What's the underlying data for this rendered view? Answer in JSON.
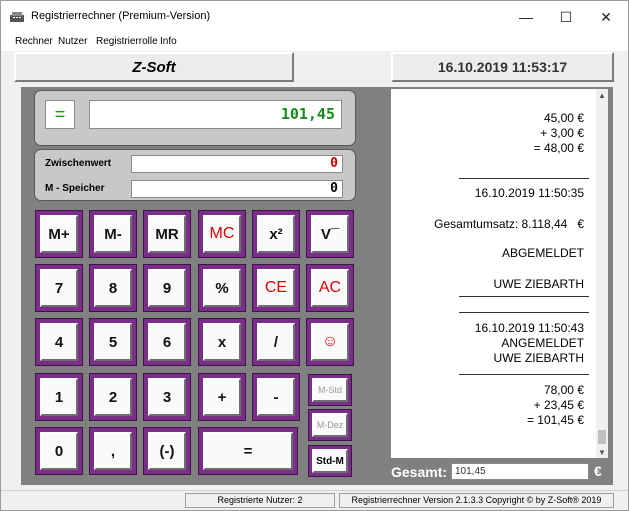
{
  "window": {
    "title": "Registrierrechner (Premium-Version)",
    "minimize": "—",
    "maximize": "☐",
    "close": "✕"
  },
  "menu": [
    "Rechner",
    "Nutzer",
    "Registrierrolle",
    "Info"
  ],
  "header": {
    "brand": "Z-Soft",
    "datetime": "16.10.2019 11:53:17"
  },
  "calculator": {
    "operator_indicator": "=",
    "display": "101,45",
    "zwischenwert_label": "Zwischenwert",
    "zwischenwert_value": "0",
    "mspeicher_label": "M - Speicher",
    "mspeicher_value": "0",
    "keys": {
      "mplus": "M+",
      "mminus": "M-",
      "mr": "MR",
      "mc": "MC",
      "square": "x²",
      "sqrt": "V¯",
      "k7": "7",
      "k8": "8",
      "k9": "9",
      "percent": "%",
      "ce": "CE",
      "ac": "AC",
      "k4": "4",
      "k5": "5",
      "k6": "6",
      "multiply": "x",
      "divide": "/",
      "smiley": "☺",
      "k1": "1",
      "k2": "2",
      "k3": "3",
      "plus": "+",
      "minus": "-",
      "mstd": "M-Std",
      "k0": "0",
      "comma": ",",
      "negate": "(-)",
      "equals": "=",
      "mdez": "M-Dez",
      "stdm": "Std-M"
    },
    "colors": {
      "key_border": "#7a2e8a",
      "red_text": "#e00000",
      "display_text": "#1a8a1a",
      "zwischenwert_text": "#cc0000"
    }
  },
  "receipt": {
    "lines": [
      "45,00 €",
      "+ 3,00 €",
      "= 48,00 €",
      "16.10.2019 11:50:35",
      "Gesamtumsatz: 8.118,44   €",
      "ABGEMELDET",
      "UWE ZIEBARTH",
      "16.10.2019 11:50:43",
      "ANGEMELDET",
      "UWE ZIEBARTH",
      "78,00 €",
      "+ 23,45 €",
      "= 101,45 €"
    ],
    "gesamt_label": "Gesamt:",
    "gesamt_value": "101,45",
    "currency": "€"
  },
  "status": {
    "users": "Registrierte Nutzer: 2",
    "version": "Registrierrechner Version 2.1.3.3 Copyright © by Z-Soft® 2019"
  }
}
